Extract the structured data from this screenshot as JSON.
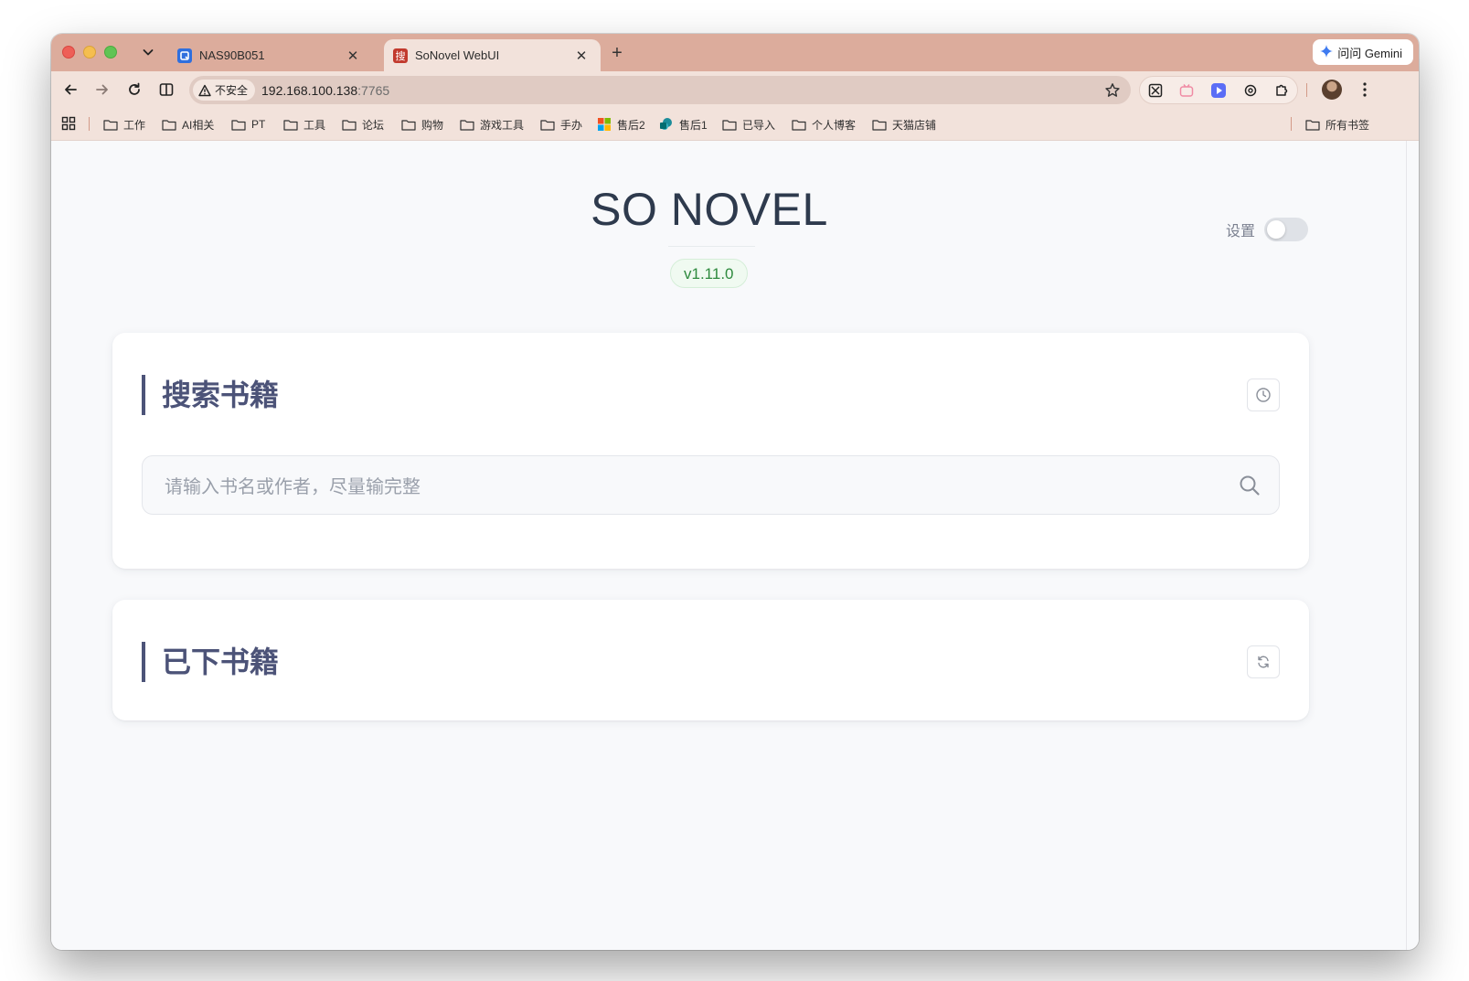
{
  "browser": {
    "tabs": [
      {
        "title": "NAS90B051",
        "active": false,
        "favicon": "nas-app-icon"
      },
      {
        "title": "SoNovel WebUI",
        "active": true,
        "favicon": "sonovel-icon",
        "favicon_glyph": "搜"
      }
    ],
    "gemini_label": "问问 Gemini",
    "security_chip": "不安全",
    "url_host": "192.168.100.138",
    "url_port": ":7765",
    "bookmarks": [
      "工作",
      "AI相关",
      "PT",
      "工具",
      "论坛",
      "购物",
      "游戏工具",
      "手办",
      "售后2",
      "售后1",
      "已导入",
      "个人博客",
      "天猫店铺"
    ],
    "all_bookmarks": "所有书签"
  },
  "app": {
    "title": "SO NOVEL",
    "version": "v1.11.0",
    "settings_label": "设置",
    "settings_enabled": false,
    "search_card": {
      "title": "搜索书籍",
      "placeholder": "请输入书名或作者，尽量输完整"
    },
    "downloaded_card": {
      "title": "已下书籍"
    }
  },
  "colors": {
    "accent": "#4c5378",
    "version_green": "#2e8a3e",
    "tab_strip": "#dcac9c",
    "toolbar": "#f2e2db"
  }
}
